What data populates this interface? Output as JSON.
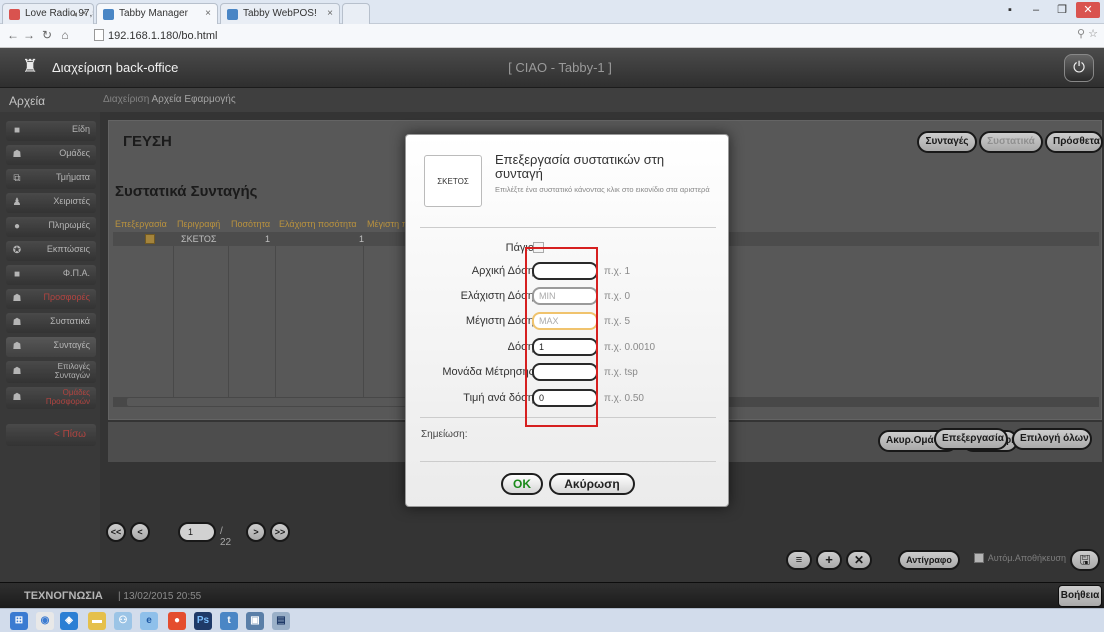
{
  "browser": {
    "tabs": [
      {
        "label": "Love Radio 97,5",
        "fav_color": "#d9534f"
      },
      {
        "label": "Tabby Manager",
        "fav_color": "#4a86c5"
      },
      {
        "label": "Tabby WebPOS!",
        "fav_color": "#4a86c5"
      }
    ],
    "url": "192.168.1.180/bo.html"
  },
  "app": {
    "title": "Διαχείριση back-office",
    "station": "[ CIAO - Tabby-1 ]",
    "files_label": "Αρχεία",
    "breadcrumb_prefix": "Διαχείριση",
    "breadcrumb_current": "Αρχεία Εφαρμογής"
  },
  "sidebar": {
    "items": [
      {
        "label": "Είδη",
        "icon": "square-icon",
        "color": "normal"
      },
      {
        "label": "Ομάδες",
        "icon": "group-icon",
        "color": "normal"
      },
      {
        "label": "Τμήματα",
        "icon": "departments-icon",
        "color": "normal"
      },
      {
        "label": "Χειριστές",
        "icon": "user-icon",
        "color": "normal"
      },
      {
        "label": "Πληρωμές",
        "icon": "payment-icon",
        "color": "normal"
      },
      {
        "label": "Εκπτώσεις",
        "icon": "discount-icon",
        "color": "normal"
      },
      {
        "label": "Φ.Π.Α.",
        "icon": "square-icon",
        "color": "normal"
      },
      {
        "label": "Προσφορές",
        "icon": "group-icon",
        "color": "red"
      },
      {
        "label": "Συστατικά",
        "icon": "group-icon",
        "color": "normal"
      },
      {
        "label": "Συνταγές",
        "icon": "group-icon",
        "color": "active"
      },
      {
        "label": "Επιλογές Συνταγών",
        "icon": "group-icon",
        "color": "normal"
      },
      {
        "label": "Ομάδες Προσφορών",
        "icon": "group-icon",
        "color": "red"
      }
    ],
    "back_label": "< Πίσω"
  },
  "main": {
    "section_title": "ΓΕΥΣΗ",
    "subtitle": "Συστατικά Συνταγής",
    "top_buttons": [
      "Συνταγές",
      "Συστατικά",
      "Πρόσθετα"
    ],
    "table": {
      "headers": [
        "Επεξεργασία",
        "Περιγραφή",
        "Ποσότητα",
        "Ελάχιστη ποσότητα",
        "Μέγιστη π"
      ],
      "rows": [
        {
          "description": "ΣΚΕΤΟΣ",
          "qty": "1",
          "min_qty": "1"
        }
      ]
    },
    "action_buttons": [
      "Ακυρ.Ομάδ/σης",
      "Διαγραφή",
      "Επεξεργασία",
      "Επιλογή όλων"
    ],
    "pager": {
      "first": "<<",
      "prev": "<",
      "current": "1",
      "total": "/ 22",
      "next": ">",
      "last": ">>"
    },
    "bottom_buttons": {
      "copy": "Αντίγραφο",
      "autosave": "Αυτόμ.Αποθήκευση"
    }
  },
  "footer": {
    "company": "ΤΕΧΝΟΓΝΩΣΙΑ",
    "datetime": "| 13/02/2015 20:55",
    "help": "Βοήθεια"
  },
  "modal": {
    "thumb_label": "ΣΚΕΤΟΣ",
    "title": "Επεξεργασία συστατικών στη συνταγή",
    "hint": "Επιλέξτε ένα συστατικό κάνοντας κλικ στο εικονίδιο στα αριστερά",
    "fixed_label": "Πάγιο",
    "fields": [
      {
        "label": "Αρχική Δόση",
        "value": "",
        "placeholder": "",
        "example": "π.χ. 1"
      },
      {
        "label": "Ελάχιστη Δόση",
        "value": "",
        "placeholder": "MIN",
        "example": "π.χ. 0"
      },
      {
        "label": "Μέγιστη Δόση",
        "value": "",
        "placeholder": "MAX",
        "example": "π.χ. 5"
      },
      {
        "label": "Δόση",
        "value": "1",
        "placeholder": "",
        "example": "π.χ. 0.0010"
      },
      {
        "label": "Μονάδα Μέτρησης",
        "value": "",
        "placeholder": "",
        "example": "π.χ. tsp"
      },
      {
        "label": "Τιμή ανά δόση",
        "value": "0",
        "placeholder": "",
        "example": "π.χ. 0.50"
      }
    ],
    "note_label": "Σημείωση:",
    "ok_label": "OK",
    "cancel_label": "Ακύρωση"
  }
}
